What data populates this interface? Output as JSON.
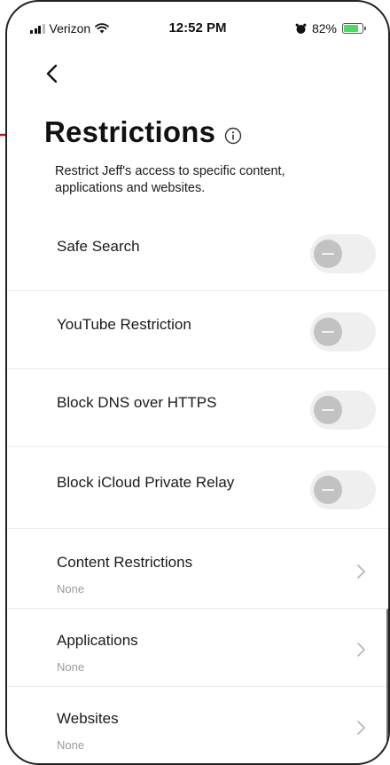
{
  "status_bar": {
    "carrier": "Verizon",
    "time": "12:52 PM",
    "battery_percent": "82%",
    "battery_level": 0.82,
    "icons": [
      "signal-bars-icon",
      "wifi-icon",
      "alarm-icon",
      "battery-charging-icon"
    ],
    "colors": {
      "battery": "#4cd964"
    }
  },
  "header": {
    "back_icon": "chevron-left-icon",
    "title": "Restrictions",
    "info_icon": "info-circle-icon",
    "description": "Restrict Jeff's access to specific content, applications and websites."
  },
  "annotation": {
    "icon": "arrow-right-icon",
    "color": "#b3202a"
  },
  "toggles": [
    {
      "label": "Safe Search",
      "state": "off"
    },
    {
      "label": "YouTube Restriction",
      "state": "off"
    },
    {
      "label": "Block DNS over HTTPS",
      "state": "off"
    },
    {
      "label": "Block iCloud Private Relay",
      "state": "off"
    }
  ],
  "links": [
    {
      "label": "Content Restrictions",
      "value": "None"
    },
    {
      "label": "Applications",
      "value": "None"
    },
    {
      "label": "Websites",
      "value": "None"
    }
  ]
}
